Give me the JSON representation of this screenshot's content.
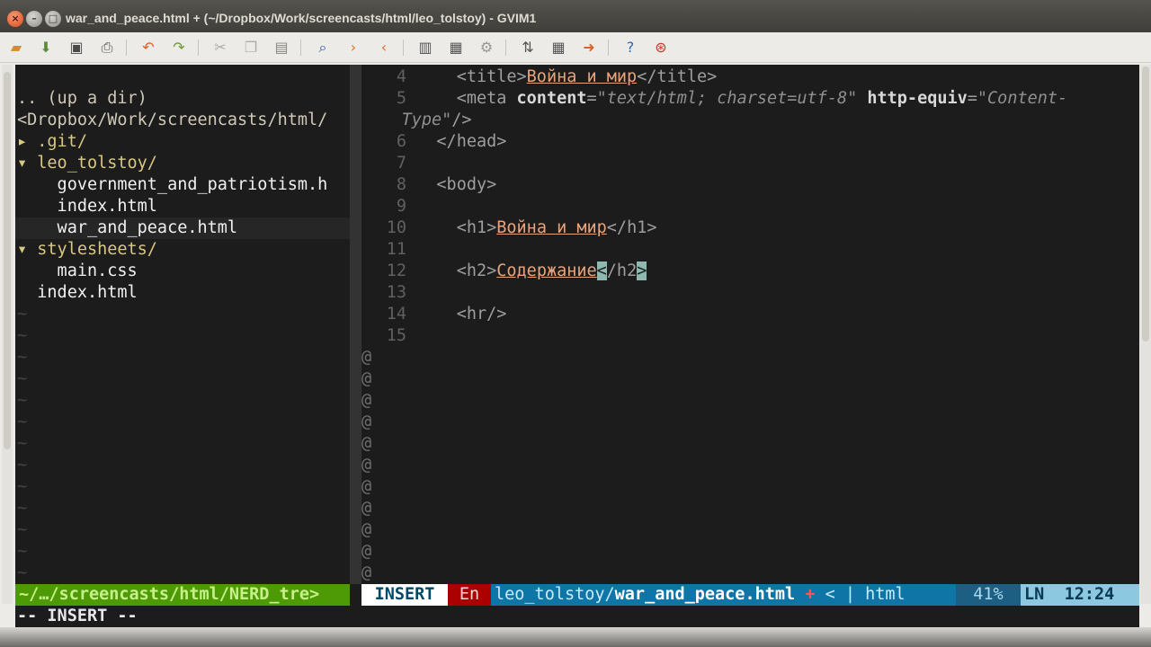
{
  "window": {
    "title": "war_and_peace.html + (~/Dropbox/Work/screencasts/html/leo_tolstoy) - GVIM1",
    "close_glyph": "×",
    "minimize_glyph": "–",
    "maximize_glyph": "□"
  },
  "toolbar": {
    "icons": [
      "open-icon",
      "save-session-icon",
      "save-icon",
      "print-icon",
      "undo-icon",
      "redo-icon",
      "cut-icon",
      "copy-icon",
      "paste-icon",
      "find-replace-icon",
      "find-next-icon",
      "find-previous-icon",
      "load-session-icon",
      "save-session-icon",
      "run-script-icon",
      "make-icon",
      "shell-icon",
      "ctags-icon",
      "help-icon",
      "find-help-icon"
    ]
  },
  "nerdtree": {
    "lines": [
      ".. (up a dir)",
      "<Dropbox/Work/screencasts/html/",
      "▸ .git/",
      "▾ leo_tolstoy/",
      "    government_and_patriotism.h",
      "    index.html",
      "    war_and_peace.html",
      "▾ stylesheets/",
      "    main.css",
      "  index.html"
    ],
    "tilde": "~"
  },
  "code": {
    "line4": {
      "num": "4",
      "open": "<title>",
      "text": "Война и мир",
      "close": "</title>"
    },
    "line5": {
      "num": "5",
      "pre": "<meta ",
      "attr1": "content",
      "eq1": "=",
      "val1": "\"text/html; charset=utf-8\"",
      "sp": " ",
      "attr2": "http-equiv",
      "eq2": "=",
      "val2": "\"Content-"
    },
    "line5b": {
      "val": "Type\"",
      "close": "/>"
    },
    "line6": {
      "num": "6",
      "tag": "</head>"
    },
    "line7": {
      "num": "7"
    },
    "line8": {
      "num": "8",
      "tag": "<body>"
    },
    "line9": {
      "num": "9"
    },
    "line10": {
      "num": "10",
      "open": "<h1>",
      "text": "Война и мир",
      "close": "</h1>"
    },
    "line11": {
      "num": "11"
    },
    "line12": {
      "num": "12",
      "open": "<h2>",
      "text": "Содержание",
      "cursor": "<",
      "close": "/h2",
      "cursor2": ">"
    },
    "line13": {
      "num": "13"
    },
    "line14": {
      "num": "14",
      "tag": "<hr/>"
    },
    "line15": {
      "num": "15"
    },
    "filler": "@"
  },
  "statusline": {
    "nerd": "~/…/screencasts/html/NERD_tre>",
    "mode": "INSERT",
    "lang": "En",
    "dir": "leo_tolstoy/",
    "file": "war_and_peace.html",
    "modified": "+",
    "sep": "<",
    "bar": "|",
    "filetype": "html",
    "percent": "41%",
    "ln": "LN",
    "position": "12:24"
  },
  "cmdline": "-- INSERT --"
}
